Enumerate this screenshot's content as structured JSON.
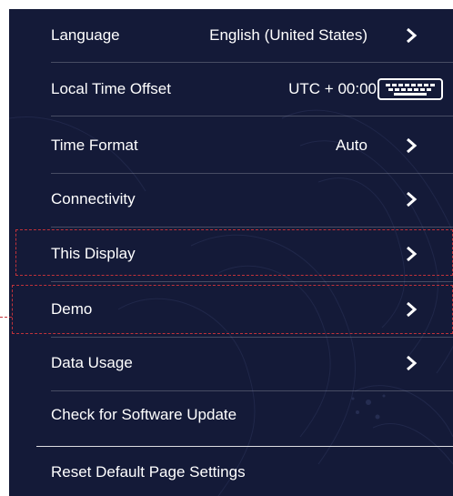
{
  "settings": {
    "items": [
      {
        "label": "Language",
        "value": "English (United States)",
        "control": "chevron-right-icon"
      },
      {
        "label": "Local Time Offset",
        "value": "UTC + 00:00",
        "control": "keyboard-icon"
      },
      {
        "label": "Time Format",
        "value": "Auto",
        "control": "chevron-right-icon"
      },
      {
        "label": "Connectivity",
        "value": "",
        "control": "chevron-right-icon"
      },
      {
        "label": "This Display",
        "value": "",
        "control": "chevron-right-icon",
        "highlighted": true
      },
      {
        "label": "Demo",
        "value": "",
        "control": "chevron-right-icon",
        "highlighted": true
      },
      {
        "label": "Data Usage",
        "value": "",
        "control": "chevron-right-icon"
      },
      {
        "label": "Check for Software Update",
        "value": "",
        "control": ""
      },
      {
        "label": "Reset Default Page Settings",
        "value": "",
        "control": ""
      }
    ]
  },
  "colors": {
    "background": "#141a38",
    "text": "#ffffff",
    "divider": "#3a3f5c",
    "highlight_border": "#c0323a"
  }
}
